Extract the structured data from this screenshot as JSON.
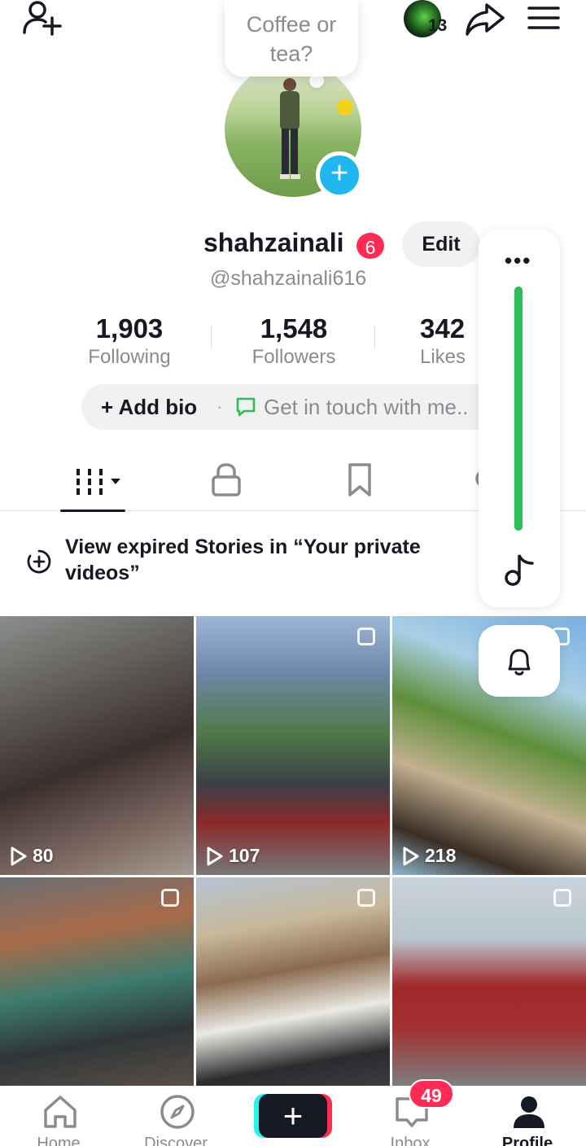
{
  "note": {
    "text_line1": "Coffee or",
    "text_line2": "tea?"
  },
  "header": {
    "follower_story_count": "13"
  },
  "profile": {
    "username": "shahzainali",
    "username_badge": "6",
    "edit_label": "Edit",
    "handle": "@shahzainali616"
  },
  "stats": {
    "following": {
      "value": "1,903",
      "label": "Following"
    },
    "followers": {
      "value": "1,548",
      "label": "Followers"
    },
    "likes": {
      "value": "342",
      "label": "Likes"
    }
  },
  "bio": {
    "add_label": "+ Add bio",
    "separator": "·",
    "contact_label": "Get in touch with me.."
  },
  "tabs": [
    {
      "name": "videos",
      "icon": "grid-icon"
    },
    {
      "name": "private",
      "icon": "lock-icon"
    },
    {
      "name": "saved",
      "icon": "bookmark-icon"
    }
  ],
  "expired_stories": {
    "text": "View expired Stories in “Your private videos”"
  },
  "side_panel": {
    "dots": "•••"
  },
  "videos": [
    {
      "views": "80",
      "multi": false
    },
    {
      "views": "107",
      "multi": true
    },
    {
      "views": "218",
      "multi": true
    },
    {
      "views": "",
      "multi": true
    },
    {
      "views": "",
      "multi": true
    },
    {
      "views": "",
      "multi": true
    }
  ],
  "bottom_nav": {
    "home": "Home",
    "discover": "Discover",
    "create": "+",
    "inbox": "Inbox",
    "inbox_badge": "49",
    "profile": "Profile"
  },
  "colors": {
    "accent_red": "#fe2c55",
    "accent_blue": "#20b7ef",
    "accent_green": "#2bbf58"
  }
}
